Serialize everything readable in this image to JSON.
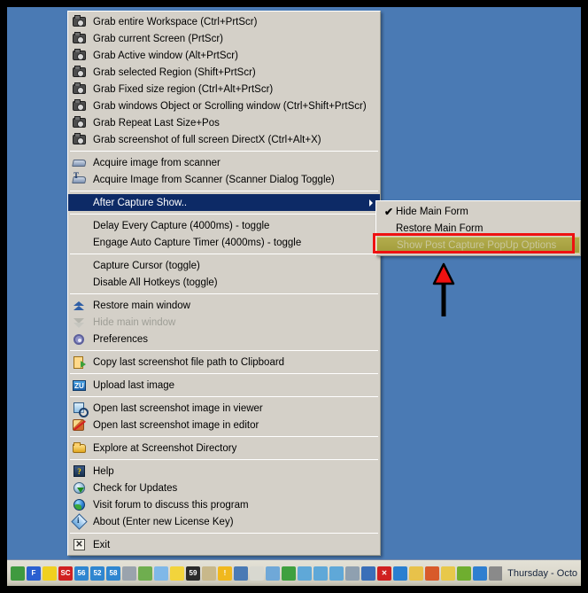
{
  "desktop": {
    "background_color": "#4a7ab4",
    "frame_color": "#000000"
  },
  "context_menu": {
    "background_color": "#d4d0c8",
    "highlight_color": "#0d2a66",
    "groups": [
      {
        "items": [
          {
            "icon": "camera-icon",
            "label": "Grab entire Workspace (Ctrl+PrtScr)"
          },
          {
            "icon": "camera-icon",
            "label": "Grab current Screen (PrtScr)"
          },
          {
            "icon": "camera-icon",
            "label": "Grab Active window (Alt+PrtScr)"
          },
          {
            "icon": "camera-icon",
            "label": "Grab selected Region (Shift+PrtScr)"
          },
          {
            "icon": "camera-icon",
            "label": "Grab Fixed size region (Ctrl+Alt+PrtScr)"
          },
          {
            "icon": "camera-icon",
            "label": "Grab windows Object or Scrolling window (Ctrl+Shift+PrtScr)"
          },
          {
            "icon": "camera-icon",
            "label": "Grab Repeat Last Size+Pos"
          },
          {
            "icon": "camera-icon",
            "label": "Grab screenshot of full screen DirectX (Ctrl+Alt+X)"
          }
        ]
      },
      {
        "items": [
          {
            "icon": "scanner-icon",
            "label": "Acquire image from scanner"
          },
          {
            "icon": "scanner-dialog-icon",
            "label": "Acquire Image from Scanner (Scanner Dialog Toggle)"
          }
        ]
      },
      {
        "items": [
          {
            "icon": "none",
            "label": "After Capture Show..",
            "selected": true,
            "has_submenu": true
          }
        ]
      },
      {
        "items": [
          {
            "icon": "none",
            "label": "Delay Every Capture (4000ms) - toggle"
          },
          {
            "icon": "none",
            "label": "Engage Auto Capture Timer (4000ms) - toggle"
          }
        ]
      },
      {
        "items": [
          {
            "icon": "none",
            "label": "Capture Cursor (toggle)"
          },
          {
            "icon": "none",
            "label": "Disable All Hotkeys (toggle)"
          }
        ]
      },
      {
        "items": [
          {
            "icon": "chevron-up-icon",
            "label": "Restore main window"
          },
          {
            "icon": "chevron-down-icon",
            "label": "Hide main window",
            "disabled": true
          },
          {
            "icon": "gear-icon",
            "label": "Preferences"
          }
        ]
      },
      {
        "items": [
          {
            "icon": "clipboard-icon",
            "label": "Copy last screenshot file path to Clipboard"
          }
        ]
      },
      {
        "items": [
          {
            "icon": "upload-zu-icon",
            "label": "Upload last image"
          }
        ]
      },
      {
        "items": [
          {
            "icon": "image-viewer-icon",
            "label": "Open last screenshot image in viewer"
          },
          {
            "icon": "image-editor-icon",
            "label": "Open last screenshot image in editor"
          }
        ]
      },
      {
        "items": [
          {
            "icon": "folder-icon",
            "label": "Explore at Screenshot Directory"
          }
        ]
      },
      {
        "items": [
          {
            "icon": "help-icon",
            "label": "Help"
          },
          {
            "icon": "update-globe-icon",
            "label": "Check for Updates"
          },
          {
            "icon": "globe-icon",
            "label": "Visit forum to discuss this program"
          },
          {
            "icon": "about-info-icon",
            "label": "About (Enter new License Key)"
          }
        ]
      },
      {
        "items": [
          {
            "icon": "exit-icon",
            "label": "Exit"
          }
        ]
      }
    ]
  },
  "submenu": {
    "title": "After Capture Show..",
    "highlight_color": "#a9a441",
    "annotation_color": "#ee1111",
    "items": [
      {
        "label": "Hide Main Form",
        "checked": true,
        "check_glyph": "✔"
      },
      {
        "label": "Restore Main Form",
        "checked": false
      },
      {
        "label": "Show Post Capture PopUp Options",
        "checked": false,
        "highlighted": true,
        "disabled": true,
        "annotated": true
      }
    ]
  },
  "annotations": {
    "arrow": {
      "name": "red-up-arrow",
      "color": "#ee1111",
      "points_to": "Show Post Capture PopUp Options"
    },
    "rectangle": {
      "name": "red-highlight-rectangle",
      "color": "#ee1111"
    }
  },
  "taskbar": {
    "clock": "Thursday - Octo",
    "tray_icons": [
      {
        "name": "green-arrow-tray-icon",
        "color": "#3f9a3f",
        "glyph": ""
      },
      {
        "name": "f-blue-tray-icon",
        "color": "#2a5fd0",
        "glyph": "F"
      },
      {
        "name": "bat-yellow-tray-icon",
        "color": "#f0d020",
        "glyph": ""
      },
      {
        "name": "sc-red-tray-icon",
        "color": "#d02020",
        "glyph": "SC"
      },
      {
        "name": "cpu-meter-56-tray-icon",
        "color": "#2f86d0",
        "glyph": "56"
      },
      {
        "name": "cpu-meter-52-tray-icon",
        "color": "#2f86d0",
        "glyph": "52"
      },
      {
        "name": "cpu-meter-58-tray-icon",
        "color": "#2f86d0",
        "glyph": "58"
      },
      {
        "name": "monitor-gray-tray-icon",
        "color": "#9aa3ad",
        "glyph": ""
      },
      {
        "name": "check-green-tray-icon",
        "color": "#6fae4f",
        "glyph": ""
      },
      {
        "name": "window-blue-tray-icon",
        "color": "#7fb8e8",
        "glyph": ""
      },
      {
        "name": "heart-yellow-tray-icon",
        "color": "#f2d43c",
        "glyph": ""
      },
      {
        "name": "counter-59-tray-icon",
        "color": "#2a2a2a",
        "glyph": "59"
      },
      {
        "name": "clock-tray-icon",
        "color": "#c8b88a",
        "glyph": ""
      },
      {
        "name": "warning-tray-icon",
        "color": "#f0b81e",
        "glyph": "!"
      },
      {
        "name": "network-tray-icon",
        "color": "#4a7ab4",
        "glyph": ""
      },
      {
        "name": "plug-tray-icon",
        "color": "#d8d8d0",
        "glyph": ""
      },
      {
        "name": "printer-tray-icon",
        "color": "#6fa8d8",
        "glyph": ""
      },
      {
        "name": "bars-green-tray-icon",
        "color": "#3fa03f",
        "glyph": ""
      },
      {
        "name": "grid-blue-1-tray-icon",
        "color": "#5fa8d8",
        "glyph": ""
      },
      {
        "name": "grid-blue-2-tray-icon",
        "color": "#5fa8d8",
        "glyph": ""
      },
      {
        "name": "grid-blue-3-tray-icon",
        "color": "#5fa8d8",
        "glyph": ""
      },
      {
        "name": "disc-gray-tray-icon",
        "color": "#8fa0b0",
        "glyph": ""
      },
      {
        "name": "shield-blue-tray-icon",
        "color": "#3a6fb8",
        "glyph": ""
      },
      {
        "name": "close-red-tray-icon",
        "color": "#d02020",
        "glyph": "✕"
      },
      {
        "name": "messenger-tray-icon",
        "color": "#2a7fd0",
        "glyph": ""
      },
      {
        "name": "paint-tray-icon",
        "color": "#e8c24a",
        "glyph": ""
      },
      {
        "name": "volume-tray-icon",
        "color": "#d85a2a",
        "glyph": ""
      },
      {
        "name": "notepad-tray-icon",
        "color": "#e8c84a",
        "glyph": ""
      },
      {
        "name": "nvidia-tray-icon",
        "color": "#6fae2f",
        "glyph": ""
      },
      {
        "name": "smiley-blue-tray-icon",
        "color": "#2f7fd0",
        "glyph": ""
      },
      {
        "name": "spiral-gray-tray-icon",
        "color": "#8a8a8a",
        "glyph": ""
      }
    ]
  }
}
